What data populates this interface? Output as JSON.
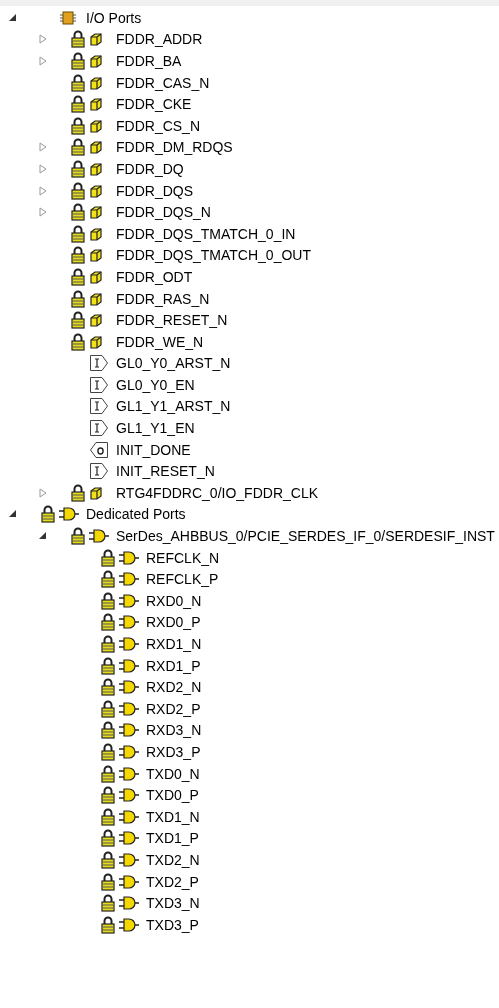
{
  "tree": [
    {
      "label": "I/O Ports",
      "kind": "chip",
      "locked": false,
      "expandable": true,
      "expanded": true,
      "children": [
        {
          "label": "FDDR_ADDR",
          "kind": "cube",
          "locked": true,
          "expandable": true,
          "expanded": false
        },
        {
          "label": "FDDR_BA",
          "kind": "cube",
          "locked": true,
          "expandable": true,
          "expanded": false
        },
        {
          "label": "FDDR_CAS_N",
          "kind": "cube",
          "locked": true,
          "expandable": false
        },
        {
          "label": "FDDR_CKE",
          "kind": "cube",
          "locked": true,
          "expandable": false
        },
        {
          "label": "FDDR_CS_N",
          "kind": "cube",
          "locked": true,
          "expandable": false
        },
        {
          "label": "FDDR_DM_RDQS",
          "kind": "cube",
          "locked": true,
          "expandable": true,
          "expanded": false
        },
        {
          "label": "FDDR_DQ",
          "kind": "cube",
          "locked": true,
          "expandable": true,
          "expanded": false
        },
        {
          "label": "FDDR_DQS",
          "kind": "cube",
          "locked": true,
          "expandable": true,
          "expanded": false
        },
        {
          "label": "FDDR_DQS_N",
          "kind": "cube",
          "locked": true,
          "expandable": true,
          "expanded": false
        },
        {
          "label": "FDDR_DQS_TMATCH_0_IN",
          "kind": "cube",
          "locked": true,
          "expandable": false
        },
        {
          "label": "FDDR_DQS_TMATCH_0_OUT",
          "kind": "cube",
          "locked": true,
          "expandable": false
        },
        {
          "label": "FDDR_ODT",
          "kind": "cube",
          "locked": true,
          "expandable": false
        },
        {
          "label": "FDDR_RAS_N",
          "kind": "cube",
          "locked": true,
          "expandable": false
        },
        {
          "label": "FDDR_RESET_N",
          "kind": "cube",
          "locked": true,
          "expandable": false
        },
        {
          "label": "FDDR_WE_N",
          "kind": "cube",
          "locked": true,
          "expandable": false
        },
        {
          "label": "GL0_Y0_ARST_N",
          "kind": "input",
          "locked": false,
          "expandable": false
        },
        {
          "label": "GL0_Y0_EN",
          "kind": "input",
          "locked": false,
          "expandable": false
        },
        {
          "label": "GL1_Y1_ARST_N",
          "kind": "input",
          "locked": false,
          "expandable": false
        },
        {
          "label": "GL1_Y1_EN",
          "kind": "input",
          "locked": false,
          "expandable": false
        },
        {
          "label": "INIT_DONE",
          "kind": "output",
          "locked": false,
          "expandable": false
        },
        {
          "label": "INIT_RESET_N",
          "kind": "input",
          "locked": false,
          "expandable": false
        },
        {
          "label": "RTG4FDDRC_0/IO_FDDR_CLK",
          "kind": "cube",
          "locked": true,
          "expandable": true,
          "expanded": false
        }
      ]
    },
    {
      "label": "Dedicated Ports",
      "kind": "plug",
      "locked": true,
      "expandable": true,
      "expanded": true,
      "children": [
        {
          "label": "SerDes_AHBBUS_0/PCIE_SERDES_IF_0/SERDESIF_INST",
          "kind": "plug",
          "locked": true,
          "expandable": true,
          "expanded": true,
          "children": [
            {
              "label": "REFCLK_N",
              "kind": "plug",
              "locked": true,
              "expandable": false
            },
            {
              "label": "REFCLK_P",
              "kind": "plug",
              "locked": true,
              "expandable": false
            },
            {
              "label": "RXD0_N",
              "kind": "plug",
              "locked": true,
              "expandable": false
            },
            {
              "label": "RXD0_P",
              "kind": "plug",
              "locked": true,
              "expandable": false
            },
            {
              "label": "RXD1_N",
              "kind": "plug",
              "locked": true,
              "expandable": false
            },
            {
              "label": "RXD1_P",
              "kind": "plug",
              "locked": true,
              "expandable": false
            },
            {
              "label": "RXD2_N",
              "kind": "plug",
              "locked": true,
              "expandable": false
            },
            {
              "label": "RXD2_P",
              "kind": "plug",
              "locked": true,
              "expandable": false
            },
            {
              "label": "RXD3_N",
              "kind": "plug",
              "locked": true,
              "expandable": false
            },
            {
              "label": "RXD3_P",
              "kind": "plug",
              "locked": true,
              "expandable": false
            },
            {
              "label": "TXD0_N",
              "kind": "plug",
              "locked": true,
              "expandable": false
            },
            {
              "label": "TXD0_P",
              "kind": "plug",
              "locked": true,
              "expandable": false
            },
            {
              "label": "TXD1_N",
              "kind": "plug",
              "locked": true,
              "expandable": false
            },
            {
              "label": "TXD1_P",
              "kind": "plug",
              "locked": true,
              "expandable": false
            },
            {
              "label": "TXD2_N",
              "kind": "plug",
              "locked": true,
              "expandable": false
            },
            {
              "label": "TXD2_P",
              "kind": "plug",
              "locked": true,
              "expandable": false
            },
            {
              "label": "TXD3_N",
              "kind": "plug",
              "locked": true,
              "expandable": false
            },
            {
              "label": "TXD3_P",
              "kind": "plug",
              "locked": true,
              "expandable": false
            }
          ]
        }
      ]
    }
  ]
}
